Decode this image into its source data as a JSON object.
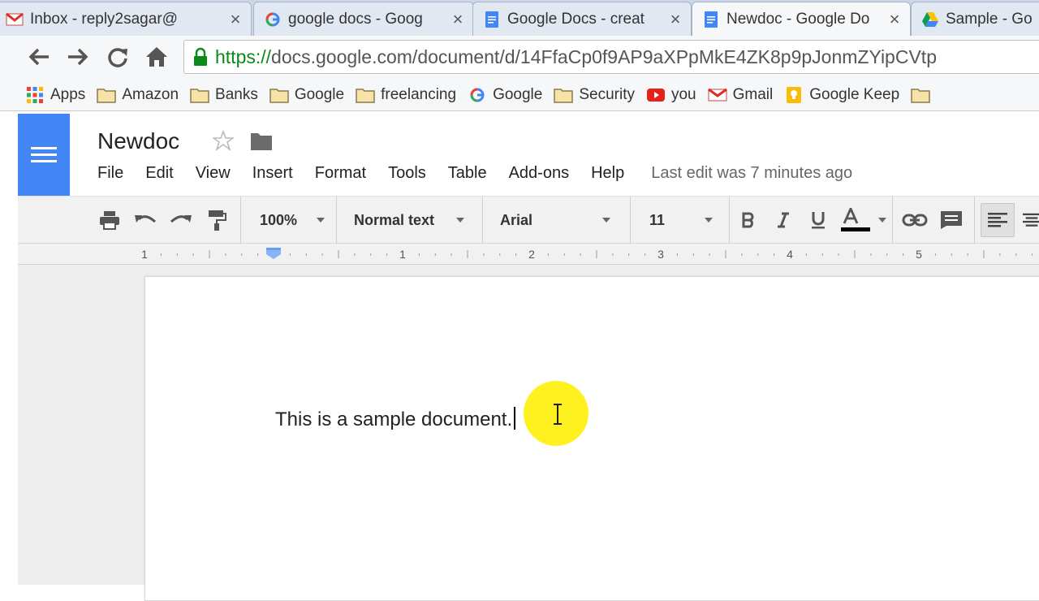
{
  "browser": {
    "tabs": [
      {
        "title": "Inbox - reply2sagar@",
        "icon": "gmail-icon",
        "active": false
      },
      {
        "title": "google docs - Goog",
        "icon": "google-icon",
        "active": false
      },
      {
        "title": "Google Docs - creat",
        "icon": "docs-icon",
        "active": false
      },
      {
        "title": "Newdoc - Google Do",
        "icon": "docs-icon",
        "active": true
      },
      {
        "title": "Sample - Go",
        "icon": "drive-icon",
        "active": false
      }
    ],
    "url_scheme": "https://",
    "url_rest": "docs.google.com/document/d/14FfaCp0f9AP9aXPpMkE4ZK8p9pJonmZYipCVtp",
    "bookmarks": [
      {
        "label": "Apps",
        "icon": "apps-grid-icon"
      },
      {
        "label": "Amazon",
        "icon": "folder-icon"
      },
      {
        "label": "Banks",
        "icon": "folder-icon"
      },
      {
        "label": "Google",
        "icon": "folder-icon"
      },
      {
        "label": "freelancing",
        "icon": "folder-icon"
      },
      {
        "label": "Google",
        "icon": "google-icon"
      },
      {
        "label": "Security",
        "icon": "folder-icon"
      },
      {
        "label": "you",
        "icon": "youtube-icon"
      },
      {
        "label": "Gmail",
        "icon": "gmail-icon"
      },
      {
        "label": "Google Keep",
        "icon": "keep-icon"
      }
    ]
  },
  "docs": {
    "title": "Newdoc",
    "menu": [
      "File",
      "Edit",
      "View",
      "Insert",
      "Format",
      "Tools",
      "Table",
      "Add-ons",
      "Help"
    ],
    "last_edit": "Last edit was 7 minutes ago",
    "toolbar": {
      "zoom": "100%",
      "style": "Normal text",
      "font": "Arial",
      "size": "11",
      "text_color": "#000000"
    },
    "ruler_labels": [
      "1",
      "1",
      "2",
      "3",
      "4",
      "5"
    ],
    "body_text": "This is a sample document."
  },
  "colors": {
    "docs_blue": "#4285f4",
    "secure_green": "#0a8a19",
    "cursor_highlight": "#ffee00"
  }
}
